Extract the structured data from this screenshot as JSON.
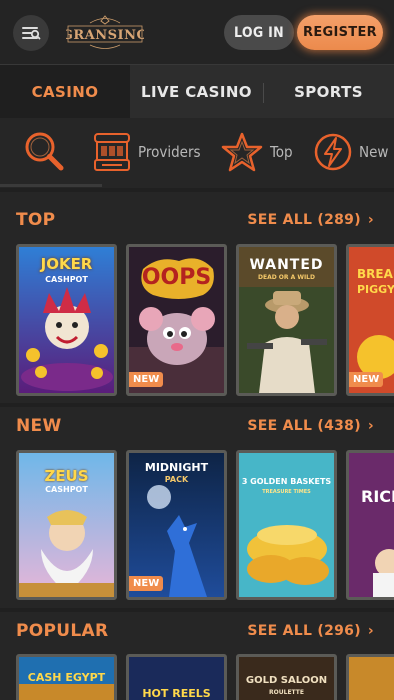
{
  "header": {
    "logo_text": "GRANSINO",
    "login_label": "LOG IN",
    "register_label": "REGISTER"
  },
  "tabs": [
    {
      "label": "CASINO",
      "active": true
    },
    {
      "label": "LIVE CASINO",
      "active": false
    },
    {
      "label": "SPORTS",
      "active": false
    }
  ],
  "categories": [
    {
      "icon": "search-icon",
      "label": ""
    },
    {
      "icon": "slot-machine-icon",
      "label": "Providers"
    },
    {
      "icon": "star-icon",
      "label": "Top"
    },
    {
      "icon": "lightning-icon",
      "label": "New"
    }
  ],
  "sections": [
    {
      "title": "TOP",
      "see_all": "SEE ALL (289)",
      "games": [
        {
          "title": "JOKER",
          "subtitle": "CASHPOT",
          "badge": ""
        },
        {
          "title": "OOPS",
          "subtitle": "",
          "badge": "NEW"
        },
        {
          "title": "WANTED",
          "subtitle": "DEAD OR A WILD",
          "badge": ""
        },
        {
          "title": "BREAK",
          "subtitle": "PIGGY",
          "badge": "NEW"
        }
      ]
    },
    {
      "title": "NEW",
      "see_all": "SEE ALL (438)",
      "games": [
        {
          "title": "ZEUS",
          "subtitle": "CASHPOT",
          "badge": ""
        },
        {
          "title": "MIDNIGHT",
          "subtitle": "PACK",
          "badge": "NEW"
        },
        {
          "title": "3 GOLDEN BASKETS",
          "subtitle": "TREASURE TIMES",
          "badge": ""
        },
        {
          "title": "RICH",
          "subtitle": "",
          "badge": ""
        }
      ]
    },
    {
      "title": "POPULAR",
      "see_all": "SEE ALL (296)",
      "games": [
        {
          "title": "CASH EGYPT",
          "subtitle": "",
          "badge": ""
        },
        {
          "title": "HOT REELS",
          "subtitle": "",
          "badge": ""
        },
        {
          "title": "GOLD SALOON",
          "subtitle": "ROULETTE",
          "badge": ""
        },
        {
          "title": "",
          "subtitle": "",
          "badge": ""
        }
      ]
    }
  ]
}
